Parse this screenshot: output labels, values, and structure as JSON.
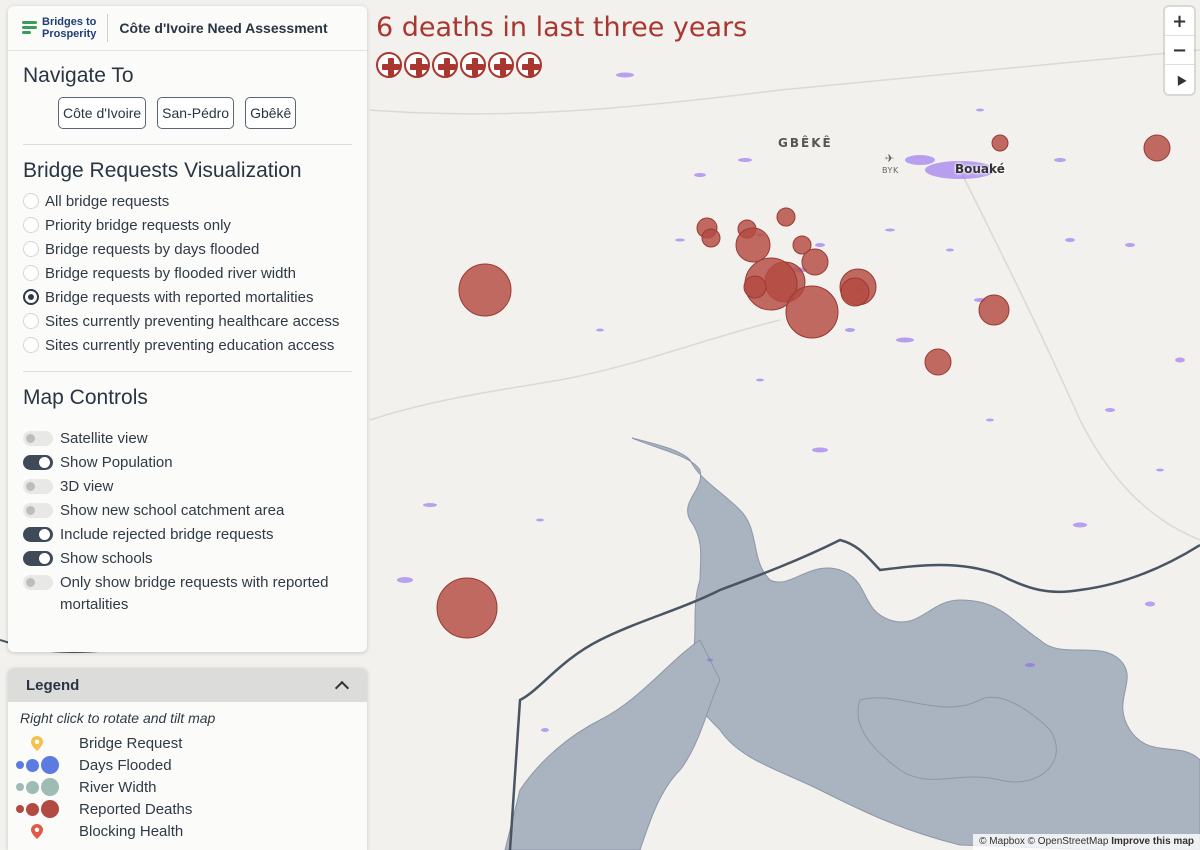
{
  "header": {
    "logo_line1": "Bridges to",
    "logo_line2": "Prosperity",
    "title": "Côte d'Ivoire Need Assessment"
  },
  "navigate": {
    "heading": "Navigate To",
    "buttons": [
      "Côte d'Ivoire",
      "San-Pédro",
      "Gbêkê"
    ]
  },
  "visualization": {
    "heading": "Bridge Requests Visualization",
    "options": [
      {
        "label": "All bridge requests",
        "selected": false
      },
      {
        "label": "Priority bridge requests only",
        "selected": false
      },
      {
        "label": "Bridge requests by days flooded",
        "selected": false
      },
      {
        "label": "Bridge requests by flooded river width",
        "selected": false
      },
      {
        "label": "Bridge requests with reported mortalities",
        "selected": true
      },
      {
        "label": "Sites currently preventing healthcare access",
        "selected": false
      },
      {
        "label": "Sites currently preventing education access",
        "selected": false
      }
    ]
  },
  "controls": {
    "heading": "Map Controls",
    "toggles": [
      {
        "label": "Satellite view",
        "on": false
      },
      {
        "label": "Show Population",
        "on": true
      },
      {
        "label": "3D view",
        "on": false
      },
      {
        "label": "Show new school catchment area",
        "on": false
      },
      {
        "label": "Include rejected bridge requests",
        "on": true
      },
      {
        "label": "Show schools",
        "on": true
      },
      {
        "label": "Only show bridge requests with reported mortalities",
        "on": false
      }
    ]
  },
  "legend": {
    "title": "Legend",
    "hint": "Right click to rotate and tilt map",
    "items": [
      {
        "label": "Bridge Request",
        "icon": "pin-icon",
        "color": "#f2c14e"
      },
      {
        "label": "Days Flooded",
        "icon": "graduated-circles-icon",
        "color": "#5b7be0"
      },
      {
        "label": "River Width",
        "icon": "graduated-circles-icon",
        "color": "#9fbcb4"
      },
      {
        "label": "Reported Deaths",
        "icon": "graduated-circles-icon",
        "color": "#b34a42"
      },
      {
        "label": "Blocking Health",
        "icon": "pin-icon",
        "color": "#e05a47"
      }
    ]
  },
  "overlay": {
    "mortality_title": "6 deaths in last three years",
    "death_count": 6
  },
  "map": {
    "region_label": "GBÊKÊ",
    "city_label": "Bouaké",
    "airport_label": "BYK",
    "attribution_prefix": "© Mapbox © OpenStreetMap",
    "attribution_link": "Improve this map"
  },
  "zoom": {
    "zoom_in": "+",
    "zoom_out": "−"
  },
  "colors": {
    "accent": "#a9372f",
    "deaths_circle": "#b34a42",
    "population": "#8a5cf0",
    "water": "#aab3c0"
  }
}
